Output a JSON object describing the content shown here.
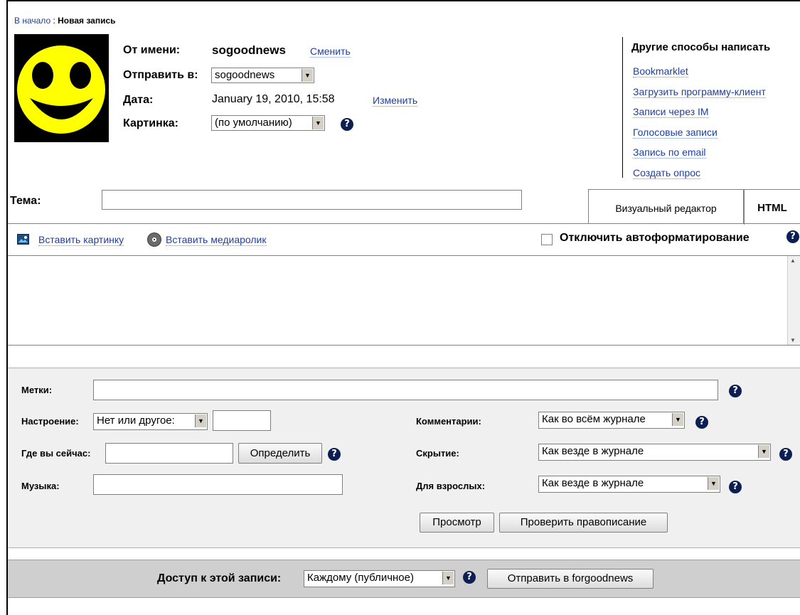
{
  "breadcrumb": {
    "home": "В начало",
    "separator": " : ",
    "current": "Новая запись"
  },
  "author": {
    "label": "От имени:",
    "name": "sogoodnews",
    "change": "Сменить"
  },
  "send_to": {
    "label": "Отправить в:",
    "value": "sogoodnews"
  },
  "date": {
    "label": "Дата:",
    "value": "January 19, 2010, 15:58",
    "change": "Изменить"
  },
  "picture": {
    "label": "Картинка:",
    "value": "(по умолчанию)"
  },
  "other_ways": {
    "title": "Другие способы написать",
    "items": [
      "Bookmarklet",
      "Загрузить программу-клиент",
      "Записи через IM",
      "Голосовые записи",
      "Запись по email",
      "Создать опрос"
    ]
  },
  "subject": {
    "label": "Тема:",
    "value": ""
  },
  "tabs": {
    "visual": "Визуальный редактор",
    "html": "HTML"
  },
  "toolbar": {
    "insert_image": "Вставить картинку",
    "insert_media": "Вставить медиаролик",
    "disable_autoformat": "Отключить автоформатирование"
  },
  "options": {
    "tags_label": "Метки:",
    "mood_label": "Настроение:",
    "mood_value": "Нет или другое:",
    "location_label": "Где вы сейчас:",
    "detect_button": "Определить",
    "music_label": "Музыка:",
    "comments_label": "Комментарии:",
    "comments_value": "Как во всём журнале",
    "screening_label": "Скрытие:",
    "screening_value": "Как везде в журнале",
    "adult_label": "Для взрослых:",
    "adult_value": "Как везде в журнале",
    "preview_button": "Просмотр",
    "spellcheck_button": "Проверить правописание"
  },
  "footer": {
    "access_label": "Доступ к этой записи:",
    "access_value": "Каждому (публичное)",
    "submit_button": "Отправить в forgoodnews"
  },
  "help_glyph": "?",
  "colors": {
    "link": "#1f3f9f",
    "smiley": "#ffff00",
    "bar": "#cfcfcf",
    "panel": "#f0f0f0"
  }
}
